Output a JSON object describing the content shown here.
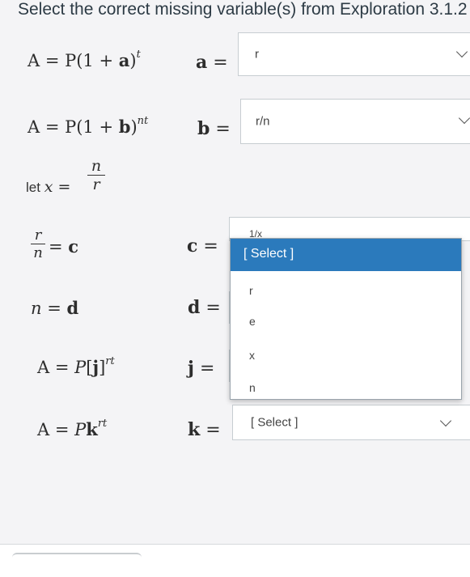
{
  "question": {
    "title": "Select the correct missing variable(s) from Exploration 3.1.2"
  },
  "rows": [
    {
      "equation": "A = P(1 + a)^t",
      "var_label": "a =",
      "selected": "r"
    },
    {
      "equation": "A = P(1 + b)^nt",
      "var_label": "b =",
      "selected": "r/n"
    },
    {
      "equation": "let x = n/r"
    },
    {
      "equation": "r/n = c",
      "var_label": "c =",
      "selected": "1/x"
    },
    {
      "equation": "n = d",
      "var_label": "d ="
    },
    {
      "equation": "A = P[j]^rt",
      "var_label": "j ="
    },
    {
      "equation": "A = Pk^rt",
      "var_label": "k =",
      "selected": "[ Select ]"
    }
  ],
  "dropdown": {
    "options": [
      "[ Select ]",
      "r",
      "e",
      "x",
      "n"
    ],
    "highlighted_index": 0,
    "highlight_color": "#2b7abc"
  },
  "colors": {
    "background": "#f4f4f6",
    "text": "#2d3b45",
    "select_border": "#c7cdd1"
  }
}
